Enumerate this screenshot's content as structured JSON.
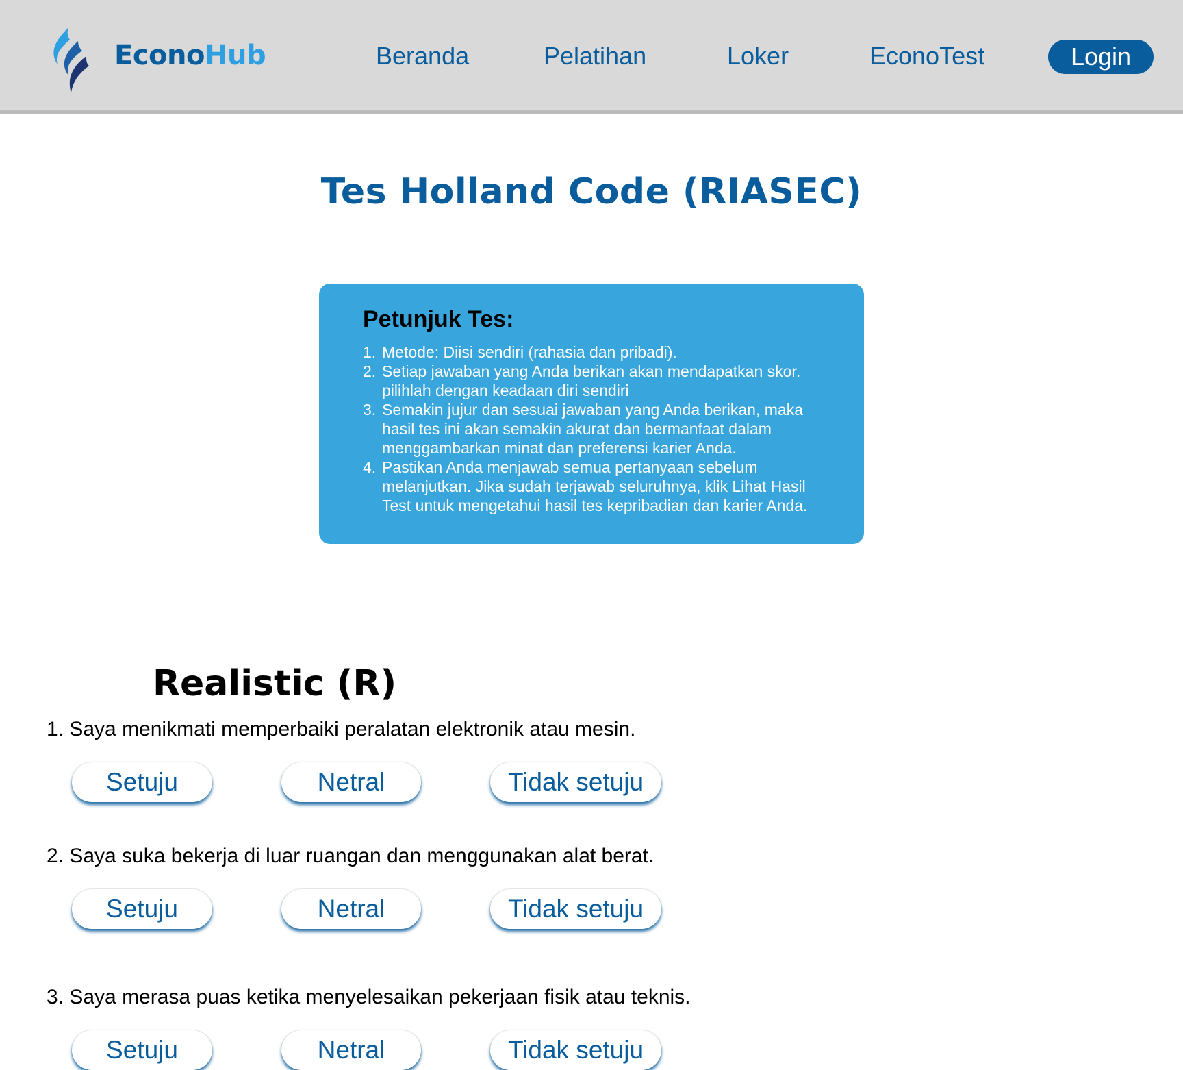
{
  "header": {
    "brand_part1": "Econo",
    "brand_part2": "Hub",
    "nav": [
      "Beranda",
      "Pelatihan",
      "Loker",
      "EconoTest"
    ],
    "login_label": "Login"
  },
  "page_title": "Tes Holland Code (RIASEC)",
  "instructions": {
    "title": "Petunjuk Tes:",
    "items": [
      {
        "num": "1.",
        "lines": [
          "Metode: Diisi sendiri (rahasia dan pribadi)."
        ]
      },
      {
        "num": "2.",
        "lines": [
          "Setiap jawaban yang Anda berikan akan mendapatkan skor.",
          "pilihlah dengan keadaan diri sendiri"
        ]
      },
      {
        "num": "3.",
        "lines": [
          "Semakin jujur dan sesuai jawaban yang Anda berikan, maka",
          "hasil tes ini akan semakin akurat dan bermanfaat dalam",
          "menggambarkan minat dan preferensi karier Anda."
        ]
      },
      {
        "num": "4.",
        "lines": [
          "Pastikan Anda menjawab semua pertanyaan sebelum",
          "melanjutkan. Jika sudah terjawab seluruhnya, klik Lihat Hasil",
          "Test untuk mengetahui hasil tes kepribadian dan karier Anda."
        ]
      }
    ]
  },
  "section": {
    "title": "Realistic (R)",
    "answer_options": [
      "Setuju",
      "Netral",
      "Tidak setuju"
    ],
    "questions": [
      "1. Saya menikmati memperbaiki peralatan elektronik atau mesin.",
      "2. Saya suka bekerja di luar ruangan dan menggunakan alat berat.",
      "3. Saya merasa puas ketika menyelesaikan pekerjaan fisik atau teknis."
    ]
  },
  "colors": {
    "header_bg": "#d9d9d9",
    "primary": "#0a5d9c",
    "accent": "#2e9fe0",
    "instruction_bg": "#38a6dd"
  }
}
